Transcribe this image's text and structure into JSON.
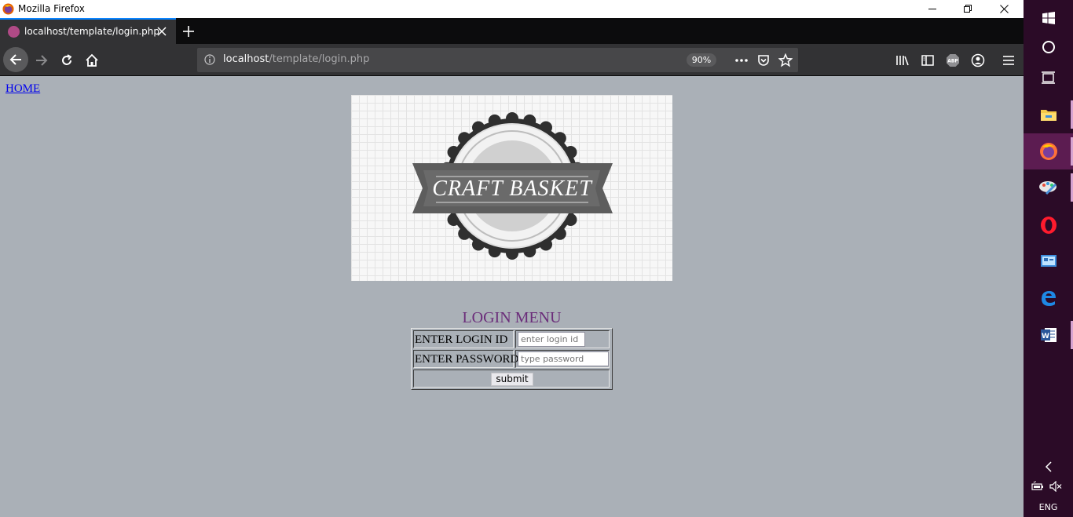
{
  "window": {
    "title": "Mozilla Firefox"
  },
  "tab": {
    "title": "localhost/template/login.php"
  },
  "urlbar": {
    "host": "localhost",
    "path": "/template/login.php",
    "zoom": "90%"
  },
  "page": {
    "home_link": "HOME",
    "logo_text": "CRAFT BASKET",
    "login_heading": "LOGIN MENU",
    "login_id_label": "ENTER LOGIN ID",
    "login_id_placeholder": "enter login id",
    "password_label": "ENTER PASSWORD",
    "password_placeholder": "type password",
    "submit_label": "submit"
  },
  "taskbar": {
    "language": "ENG",
    "pinned_apps": [
      "start-icon",
      "cortana-icon",
      "task-view-icon",
      "file-explorer-icon",
      "firefox-icon",
      "paint-icon",
      "opera-icon",
      "control-panel-icon",
      "edge-icon",
      "word-icon"
    ]
  },
  "colors": {
    "page_background": "#aab0b7",
    "heading_color": "#6b2d7a",
    "taskbar_background": "#2b0b27",
    "tab_accent": "#0a84ff"
  }
}
